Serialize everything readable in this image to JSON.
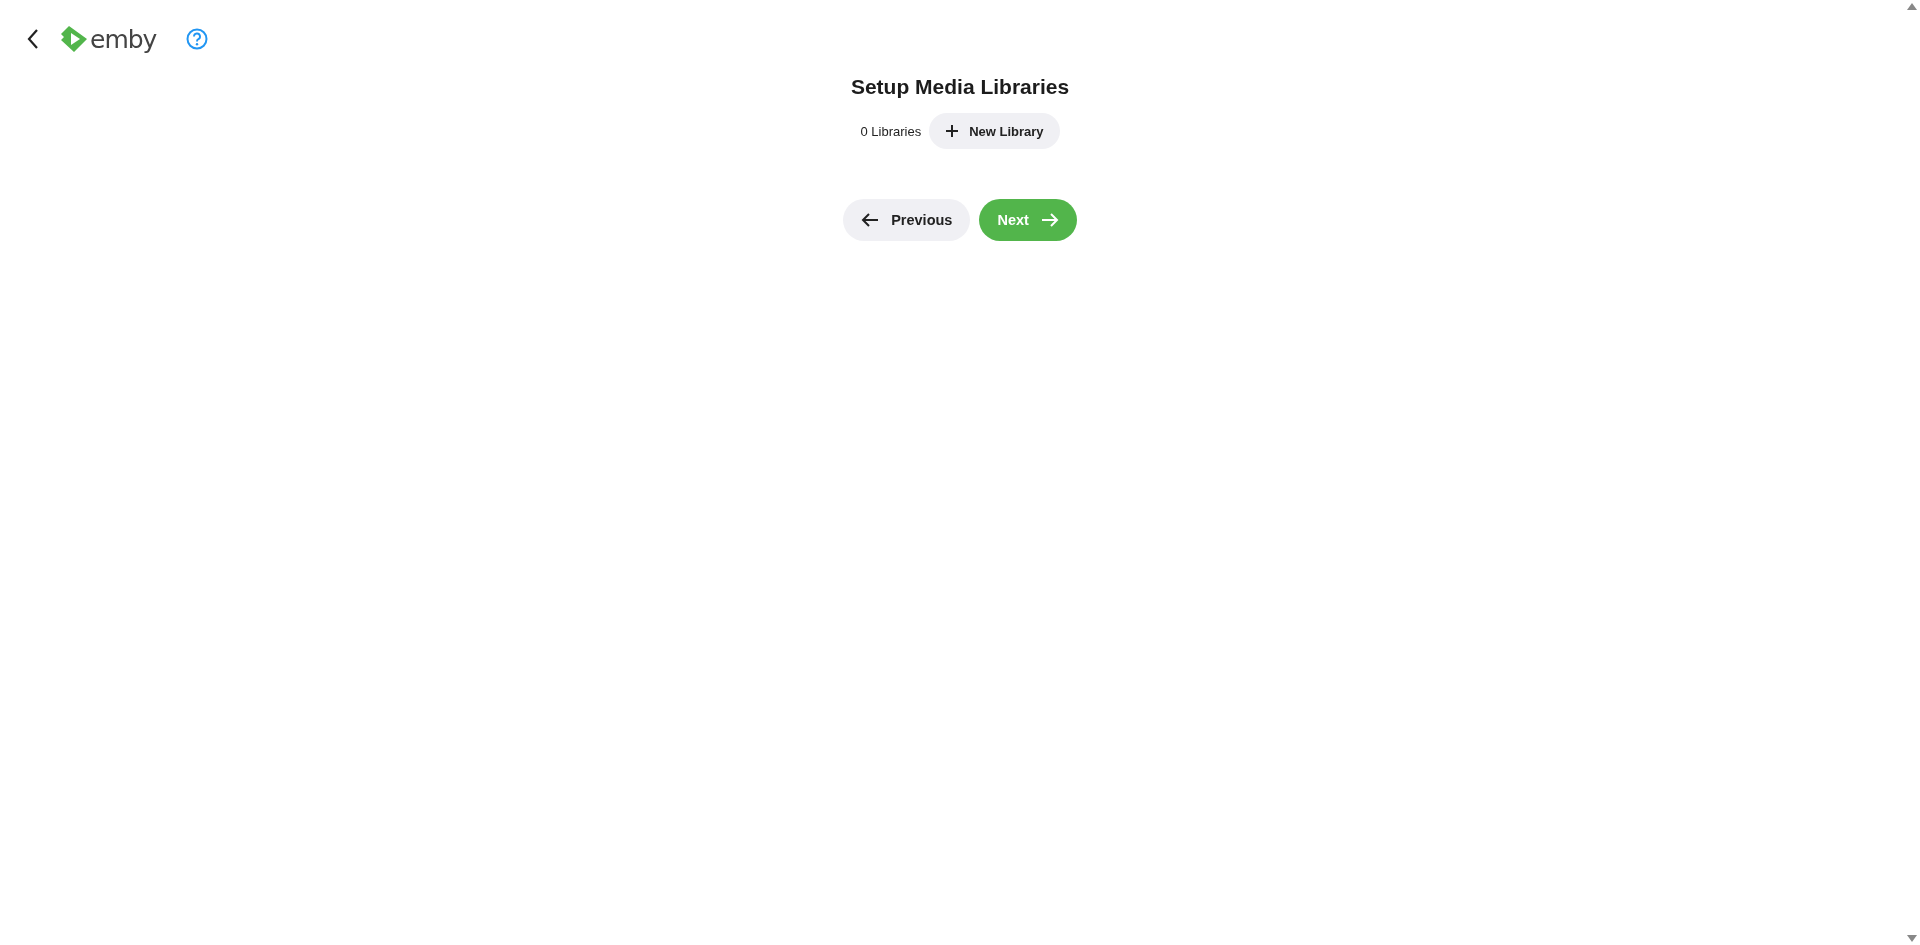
{
  "header": {
    "logo_text": "emby"
  },
  "title": "Setup Media Libraries",
  "libraries": {
    "count": "0 Libraries",
    "new_button": "New Library"
  },
  "nav": {
    "previous": "Previous",
    "next": "Next"
  }
}
